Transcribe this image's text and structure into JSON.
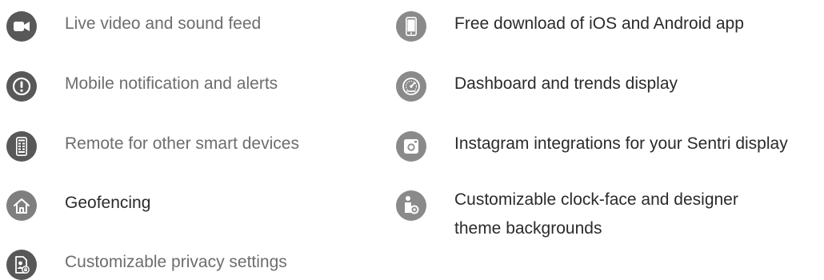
{
  "features_left": [
    {
      "label": "Live video and sound feed",
      "icon": "video-camera-icon"
    },
    {
      "label": "Mobile notification and alerts",
      "icon": "alert-icon"
    },
    {
      "label": "Remote for other smart devices",
      "icon": "remote-icon"
    },
    {
      "label": "Geofencing",
      "icon": "home-icon"
    },
    {
      "label": "Customizable privacy settings",
      "icon": "privacy-icon"
    }
  ],
  "features_right": [
    {
      "label": "Free download of iOS and Android app",
      "icon": "phone-icon"
    },
    {
      "label": "Dashboard and trends display",
      "icon": "dashboard-icon"
    },
    {
      "label": "Instagram integrations for your Sentri display",
      "icon": "instagram-icon"
    },
    {
      "label_line1": "Customizable clock-face and designer",
      "label_line2": "theme backgrounds",
      "icon": "customize-icon"
    }
  ],
  "colors": {
    "icon_dark": "#585858",
    "icon_light": "#8a8a8a",
    "text_gray": "#6d6d6d",
    "text_dark": "#2b2b2b"
  }
}
